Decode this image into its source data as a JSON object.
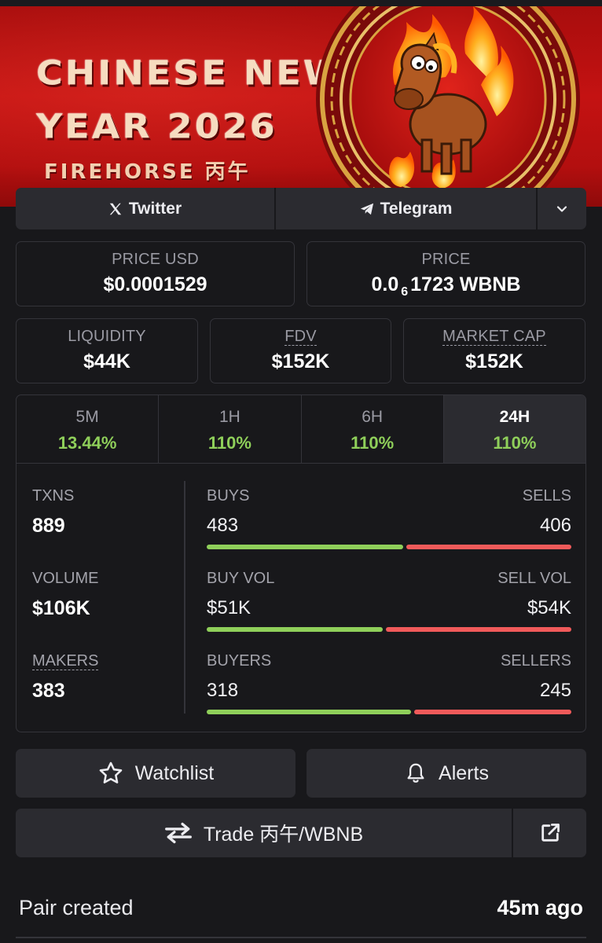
{
  "banner": {
    "title_line1": "CHINESE NEW",
    "title_line2": "YEAR 2026",
    "subtitle": "FIREHORSE 丙午"
  },
  "links": {
    "twitter": "Twitter",
    "telegram": "Telegram",
    "icons": [
      "x-logo-icon",
      "telegram-icon",
      "chevron-down-icon"
    ]
  },
  "price": {
    "usd_label": "PRICE USD",
    "usd_value": "$0.0001529",
    "native_label": "PRICE",
    "native_prefix": "0.0",
    "native_zero_count": "6",
    "native_digits": "1723",
    "native_symbol": "WBNB"
  },
  "metrics": {
    "liquidity_label": "LIQUIDITY",
    "liquidity_value": "$44K",
    "fdv_label": "FDV",
    "fdv_value": "$152K",
    "mcap_label": "MARKET CAP",
    "mcap_value": "$152K"
  },
  "timeframes": [
    {
      "label": "5M",
      "change": "13.44%"
    },
    {
      "label": "1H",
      "change": "110%"
    },
    {
      "label": "6H",
      "change": "110%"
    },
    {
      "label": "24H",
      "change": "110%"
    }
  ],
  "active_timeframe": "24H",
  "stats": {
    "txns_label": "TXNS",
    "txns_value": "889",
    "volume_label": "VOLUME",
    "volume_value": "$106K",
    "makers_label": "MAKERS",
    "makers_value": "383",
    "buys_label": "BUYS",
    "buys_value": "483",
    "sells_label": "SELLS",
    "sells_value": "406",
    "buy_vol_label": "BUY VOL",
    "buy_vol_value": "$51K",
    "sell_vol_label": "SELL VOL",
    "sell_vol_value": "$54K",
    "buyers_label": "BUYERS",
    "buyers_value": "318",
    "sellers_label": "SELLERS",
    "sellers_value": "245",
    "buy_share_txns": 0.543,
    "buy_share_volume": 0.486,
    "buy_share_makers": 0.565
  },
  "actions": {
    "watchlist": "Watchlist",
    "alerts": "Alerts",
    "trade": "Trade 丙午/WBNB"
  },
  "pair": {
    "label": "Pair created",
    "value": "45m ago"
  },
  "colors": {
    "background": "#18181b",
    "card": "#2b2b30",
    "border": "#34343a",
    "positive": "#8fcf5a",
    "negative": "#f05a5a",
    "banner_red": "#c41212",
    "gold": "#d9a441"
  }
}
